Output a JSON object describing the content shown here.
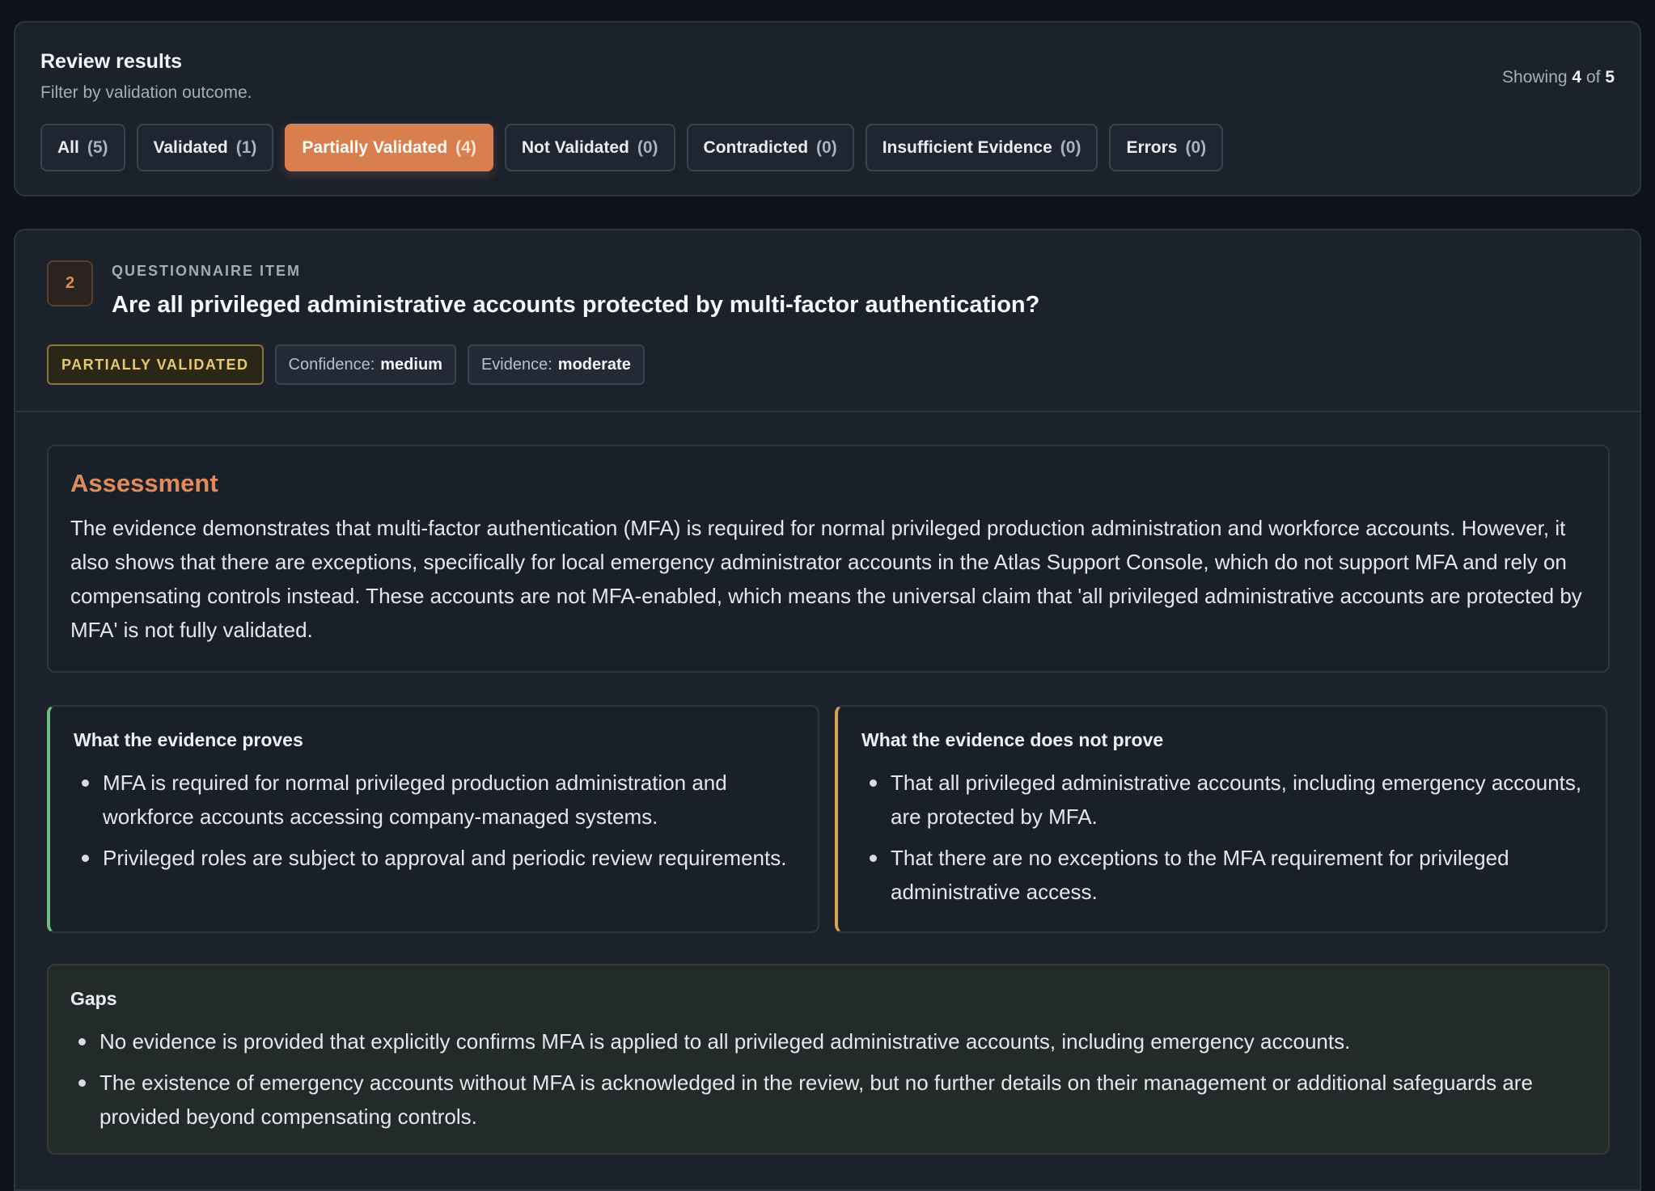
{
  "filter": {
    "title": "Review results",
    "subtitle": "Filter by validation outcome.",
    "showing_prefix": "Showing",
    "showing_count": "4",
    "showing_of": "of",
    "showing_total": "5",
    "chips": [
      {
        "label": "All",
        "count": "(5)"
      },
      {
        "label": "Validated",
        "count": "(1)"
      },
      {
        "label": "Partially Validated",
        "count": "(4)"
      },
      {
        "label": "Not Validated",
        "count": "(0)"
      },
      {
        "label": "Contradicted",
        "count": "(0)"
      },
      {
        "label": "Insufficient Evidence",
        "count": "(0)"
      },
      {
        "label": "Errors",
        "count": "(0)"
      }
    ],
    "active_index": 2
  },
  "item": {
    "number": "2",
    "label": "QUESTIONNAIRE ITEM",
    "question": "Are all privileged administrative accounts protected by multi-factor authentication?",
    "status": "PARTIALLY VALIDATED",
    "confidence_label": "Confidence:",
    "confidence_value": "medium",
    "evidence_label": "Evidence:",
    "evidence_value": "moderate"
  },
  "assessment": {
    "heading": "Assessment",
    "body": "The evidence demonstrates that multi-factor authentication (MFA) is required for normal privileged production administration and workforce accounts. However, it also shows that there are exceptions, specifically for local emergency administrator accounts in the Atlas Support Console, which do not support MFA and rely on compensating controls instead. These accounts are not MFA-enabled, which means the universal claim that 'all privileged administrative accounts are protected by MFA' is not fully validated."
  },
  "proves": {
    "heading": "What the evidence proves",
    "items": [
      "MFA is required for normal privileged production administration and workforce accounts accessing company-managed systems.",
      "Privileged roles are subject to approval and periodic review requirements."
    ]
  },
  "not_proves": {
    "heading": "What the evidence does not prove",
    "items": [
      "That all privileged administrative accounts, including emergency accounts, are protected by MFA.",
      "That there are no exceptions to the MFA requirement for privileged administrative access."
    ]
  },
  "gaps": {
    "heading": "Gaps",
    "items": [
      "No evidence is provided that explicitly confirms MFA is applied to all privileged administrative accounts, including emergency accounts.",
      "The existence of emergency accounts without MFA is acknowledged in the review, but no further details on their management or additional safeguards are provided beyond compensating controls."
    ]
  },
  "colors": {
    "accent": "#d97f4d",
    "proves_border": "#6fbf7f",
    "not_proves_border": "#d9a04e",
    "status_text": "#e7c86a"
  }
}
